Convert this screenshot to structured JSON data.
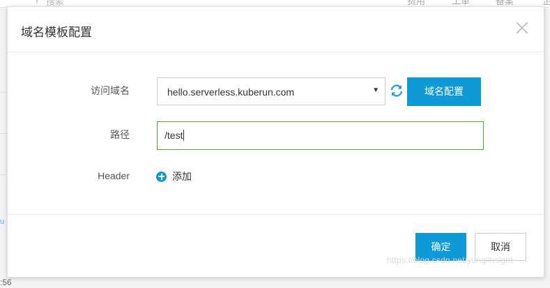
{
  "background": {
    "search_placeholder": "搜索",
    "nav_items": [
      "费用",
      "工单",
      "备案",
      "企"
    ],
    "side_text": "u",
    "time_fragment": ":56"
  },
  "modal": {
    "title": "域名模板配置",
    "close_icon": "close-icon",
    "form": {
      "domain_label": "访问域名",
      "domain_value": "hello.serverless.kuberun.com",
      "domain_config_button": "域名配置",
      "path_label": "路径",
      "path_value": "/test",
      "header_label": "Header",
      "add_label": "添加"
    },
    "footer": {
      "confirm": "确定",
      "cancel": "取消"
    }
  },
  "watermark": "https://blog.csdn.net/yunqiinsight",
  "colors": {
    "primary": "#0e9ad6",
    "focus_border": "#4ba638"
  }
}
